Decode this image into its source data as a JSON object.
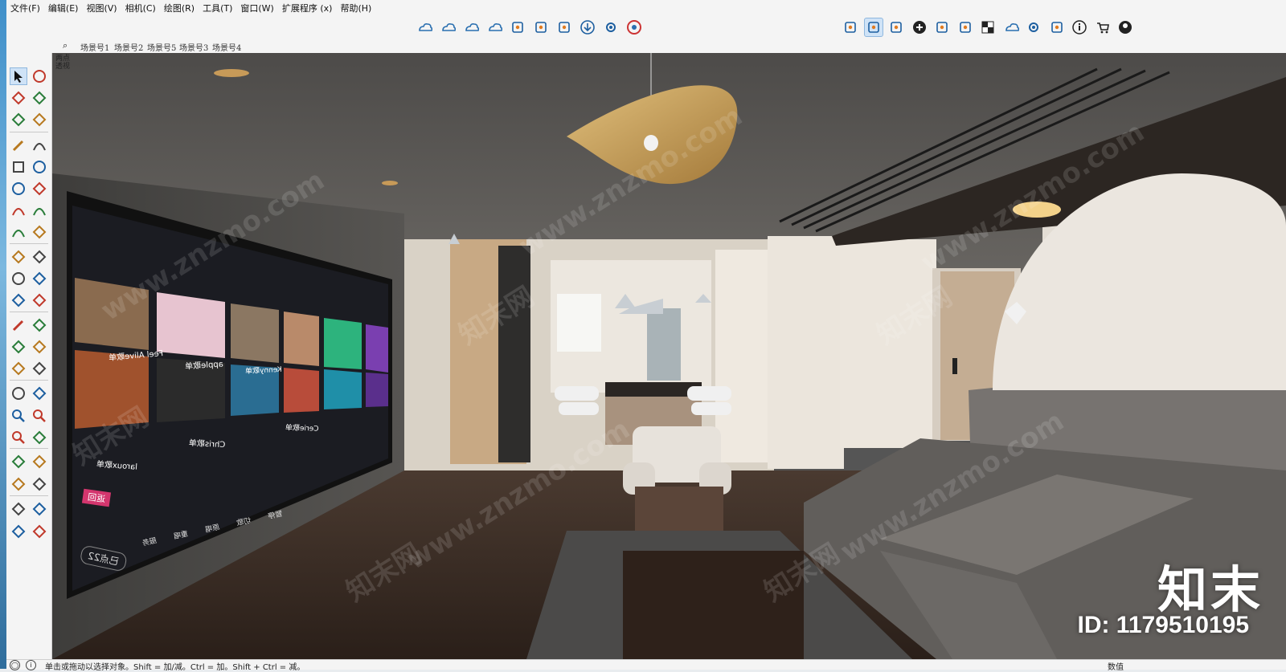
{
  "menu": [
    "文件(F)",
    "编辑(E)",
    "视图(V)",
    "相机(C)",
    "绘图(R)",
    "工具(T)",
    "窗口(W)",
    "扩展程序 (x)",
    "帮助(H)"
  ],
  "scene_tabs": [
    "场景号1",
    "场景号2",
    "场景号5",
    "场景号3",
    "场景号4"
  ],
  "view_label": "两点\n透视",
  "toolbar_center_icons": [
    "cloud-sync-icon",
    "cloud-share-icon",
    "cloud-check-icon",
    "cloud-list-icon",
    "rect-select-icon",
    "component-icon",
    "refresh-check-icon",
    "download-icon",
    "settings-gear-icon",
    "chrome-icon"
  ],
  "toolbar_right_icons": [
    "layer-check-icon",
    "swap-window-icon",
    "camera-switch-icon",
    "add-circle-icon",
    "shield-icon",
    "books-icon",
    "checker-icon",
    "cloud-upload-icon",
    "gear-sparkle-icon",
    "folder-icon",
    "info-icon",
    "cart-icon",
    "user-icon"
  ],
  "left_tools": [
    [
      "select-arrow-icon",
      "orbit-icon"
    ],
    [
      "paint-bucket-icon",
      "eraser-icon"
    ],
    [
      "make-component-icon",
      "tag-tool-icon"
    ],
    [
      "pencil-line-icon",
      "freehand-icon"
    ],
    [
      "rectangle-icon",
      "rotated-rect-icon"
    ],
    [
      "circle-icon",
      "polygon-icon"
    ],
    [
      "arc-icon",
      "two-point-arc-icon"
    ],
    [
      "three-point-arc-icon",
      "pie-icon"
    ],
    [
      "move-icon",
      "push-pull-icon"
    ],
    [
      "rotate-icon",
      "follow-me-icon"
    ],
    [
      "scale-icon",
      "offset-icon"
    ],
    [
      "tape-measure-icon",
      "dimension-icon"
    ],
    [
      "protractor-icon",
      "text-label-icon"
    ],
    [
      "axes-icon",
      "3d-text-icon"
    ],
    [
      "orbit-view-icon",
      "pan-hand-icon"
    ],
    [
      "zoom-icon",
      "zoom-window-icon"
    ],
    [
      "zoom-extents-icon",
      "previous-view-icon"
    ],
    [
      "position-camera-icon",
      "look-around-icon"
    ],
    [
      "walk-icon",
      "section-plane-icon"
    ],
    [
      "sandbox-contours-icon",
      "sandbox-scratch-icon"
    ],
    [
      "smoove-icon",
      "stamp-icon"
    ]
  ],
  "status": {
    "text": "单击或拖动以选择对象。Shift = 加/减。Ctrl = 加。Shift + Ctrl = 减。",
    "measure_label": "数值"
  },
  "watermarks": [
    "www.znzmo.com",
    "知末网"
  ],
  "brand": {
    "logo": "知末",
    "id_text": "ID: 1179510195"
  },
  "tv_screen": {
    "tiles": [
      "Feel Alive歌单",
      "apple歌单",
      "Kenny歌单",
      "Cerie歌单",
      "laroux歌单",
      "Chris歌单",
      "返回",
      "已点22"
    ],
    "controls": [
      "暂停",
      "切歌",
      "原唱",
      "重唱",
      "服务"
    ]
  },
  "colors": {
    "accent_select": "#cfe3f7",
    "wall": "#e7e1d8",
    "floor": "#3a2c24",
    "ceiling": "#5b5956",
    "pendant": "#c59a55"
  }
}
